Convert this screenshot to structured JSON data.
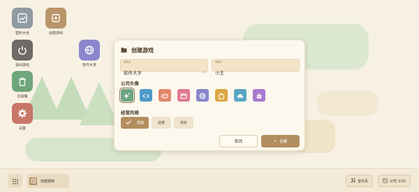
{
  "desktop": {
    "icons": [
      {
        "label": "塑料大全",
        "color": "#8f9aa3",
        "icon": "image-frame-icon"
      },
      {
        "label": "创建游戏",
        "color": "#b9956a",
        "icon": "plus-square-icon"
      },
      {
        "label": "退出游戏",
        "color": "#6f6a66",
        "icon": "power-icon"
      },
      {
        "label": "垃圾桶",
        "color": "#6fa57c",
        "icon": "trash-icon"
      },
      {
        "label": "设置",
        "color": "#c87667",
        "icon": "gear-icon"
      },
      {
        "label": "软件大亨",
        "color": "#8a86cc",
        "icon": "globe-icon"
      }
    ]
  },
  "dialog": {
    "title": "创建游戏",
    "name_field": {
      "label": "游戏名",
      "value": "软件大亨",
      "count": "4/12"
    },
    "founder_field": {
      "label": "创始人",
      "value": "小王"
    },
    "avatar_section": "公司头像",
    "avatars": [
      {
        "icon": "sparkle-icon",
        "color": "#6da583",
        "selected": true
      },
      {
        "icon": "code-icon",
        "color": "#4e9ac9"
      },
      {
        "icon": "gamepad-icon",
        "color": "#e0876a"
      },
      {
        "icon": "film-icon",
        "color": "#e17894"
      },
      {
        "icon": "globe-icon",
        "color": "#8a86cc"
      },
      {
        "icon": "bag-icon",
        "color": "#dca63f"
      },
      {
        "icon": "cloud-icon",
        "color": "#5aa6c2"
      },
      {
        "icon": "robot-icon",
        "color": "#a97ad1"
      }
    ],
    "style_section": "经营风格",
    "styles": [
      {
        "label": "稳健",
        "active": true
      },
      {
        "label": "创意",
        "active": false
      },
      {
        "label": "增长",
        "active": false
      }
    ],
    "cancel_label": "取消",
    "create_label": "创建"
  },
  "taskbar": {
    "task_label": "创建游戏",
    "music_label": "音乐关",
    "company_label": "公司 1/10"
  }
}
